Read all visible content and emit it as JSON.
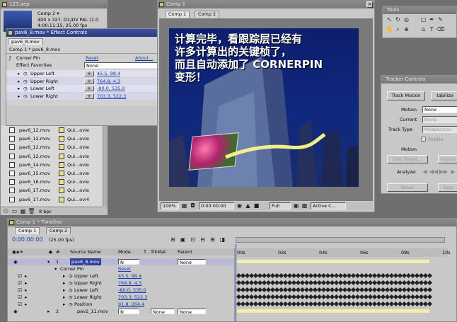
{
  "project": {
    "title": "123.aep",
    "comp_name": "Comp 2 ▾",
    "comp_info": [
      "400 x 327, D1/DV PAL (1.0",
      "4:00:11:15, 25.00 fps"
    ],
    "files": [
      {
        "name": "pav6_12.mov",
        "type": "Qui...ovie"
      },
      {
        "name": "pav6_12.mov",
        "type": "Qui...ovie"
      },
      {
        "name": "pav6_12.mov",
        "type": "Qui...ovie"
      },
      {
        "name": "pav6_12.mov",
        "type": "Qui...ovie"
      },
      {
        "name": "pav6_14.mov",
        "type": "Qui...ovie"
      },
      {
        "name": "pav6_15.mov",
        "type": "Qui...ovie"
      },
      {
        "name": "pav6_16.mov",
        "type": "Qui...ovie"
      },
      {
        "name": "pav6_17.mov",
        "type": "Qui...ovie"
      },
      {
        "name": "pav6_17.mov",
        "type": "Qui...ovi4"
      }
    ],
    "bpc": "8 bpc"
  },
  "effect_controls": {
    "title": "pav6_8.mov * Effect Controls",
    "tab": "pav6_8.mov",
    "path": "Comp 1 * pav6_8.mov",
    "effect": "Corner Pin",
    "reset": "Reset",
    "about": "About...",
    "favorites_label": "Effect Favorites",
    "favorites_value": "None",
    "params": [
      {
        "name": "Upper Left",
        "value": "45.5, 98.4"
      },
      {
        "name": "Upper Right",
        "value": "764.8, 4.3"
      },
      {
        "name": "Lower Left",
        "value": "-80.0, 535.0"
      },
      {
        "name": "Lower Right",
        "value": "703.3, 522.3"
      }
    ]
  },
  "comp_viewer": {
    "title": "Comp 1",
    "tabs": [
      "Comp 1",
      "Comp 2"
    ],
    "overlay_lines": [
      "计算完毕，看跟踪层已经有",
      "许多计算出的关键桢了，",
      "而且自动添加了 CORNERPIN",
      "变形！"
    ],
    "zoom": "100%",
    "timecode": "0:00:00:00",
    "resolution": "Full",
    "camera": "Active C..."
  },
  "tools": {
    "title": "Tools"
  },
  "tracker": {
    "title": "Tracker Controls",
    "track_motion": "Track Motion",
    "stabilize": "tabilize",
    "motion_source_label": "Motion",
    "motion_source_value": "None",
    "current_label": "Current",
    "current_value": "None",
    "track_type_label": "Track Type",
    "track_type_value": "Perspective",
    "position_label": "Positio",
    "motion_target_label": "Motion",
    "edit_target": "Edit Target...",
    "options": "Option",
    "analyze_label": "Analyze:",
    "reset": "Reset",
    "apply": "Appl"
  },
  "timeline": {
    "title": "Comp 1 * Timeline",
    "tabs": [
      "Comp 1",
      "Comp 2"
    ],
    "timecode": "0:00:00:00",
    "fps": "(25.00 fps)",
    "columns": {
      "source": "Source Name",
      "mode": "Mode",
      "t": "T",
      "trkmat": "TrkMat",
      "parent": "Parent"
    },
    "ruler": [
      "00s",
      "02s",
      "04s",
      "06s",
      "08s",
      "10s"
    ],
    "layer1": {
      "num": "1",
      "name": "pav6_8.mov",
      "mode": "N",
      "parent": "None"
    },
    "corner_pin": {
      "name": "Corner Pin",
      "reset": "Reset"
    },
    "params": [
      {
        "name": "Upper Left",
        "value": "45.5, 98.4"
      },
      {
        "name": "Upper Right",
        "value": "764.8, 4.3"
      },
      {
        "name": "Lower Left",
        "value": "-80.0, 535.0"
      },
      {
        "name": "Lower Right",
        "value": "703.3, 522.3"
      },
      {
        "name": "Position",
        "value": "91.8, 264.4"
      }
    ],
    "layer2": {
      "num": "2",
      "name": "pav2_11.mov",
      "mode": "N",
      "trkmat": "None",
      "parent": "None"
    }
  },
  "colors": {
    "titlebar": "#2f419a",
    "panel": "#c8c8c8",
    "workspace": "#6f6f6f",
    "bar": "#5e5e5e"
  }
}
